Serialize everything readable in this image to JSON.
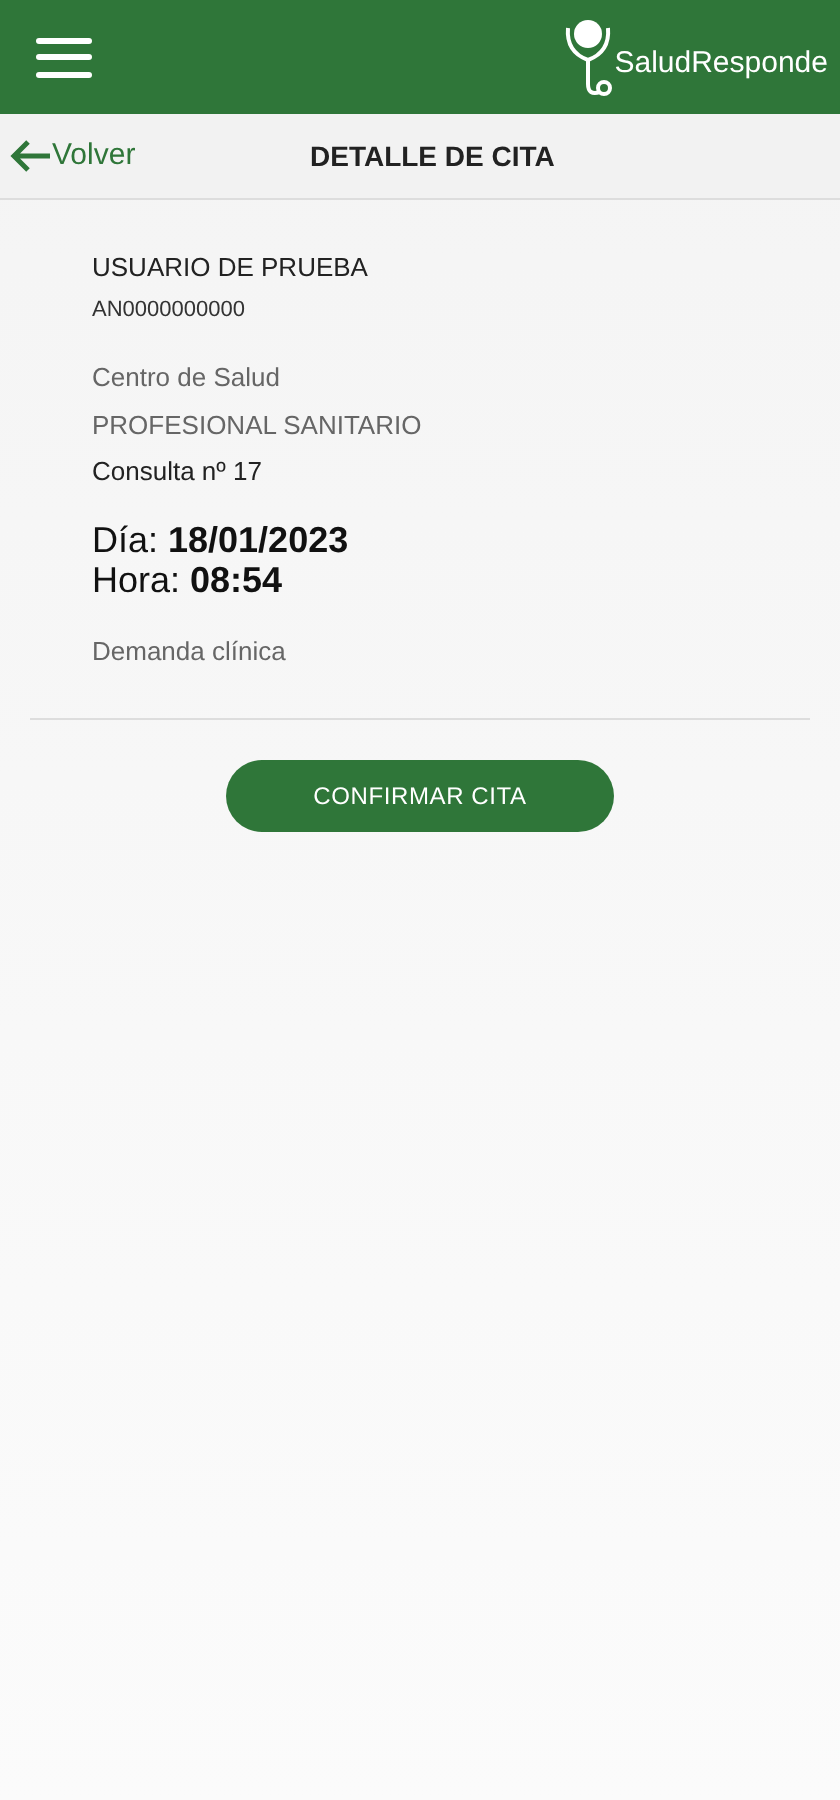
{
  "header": {
    "logo_text": "SaludResponde"
  },
  "nav": {
    "back": "Volver",
    "title": "DETALLE DE CITA"
  },
  "appointment": {
    "patient": "USUARIO DE PRUEBA",
    "patient_id": "AN0000000000",
    "center": "Centro de Salud",
    "professional": "PROFESIONAL SANITARIO",
    "room": "Consulta nº 17",
    "day": "Día: **18/01/2023**",
    "time": "Hora: **08:54**",
    "type": "Demanda clínica"
  },
  "confirm_button": "CONFIRMAR CITA"
}
